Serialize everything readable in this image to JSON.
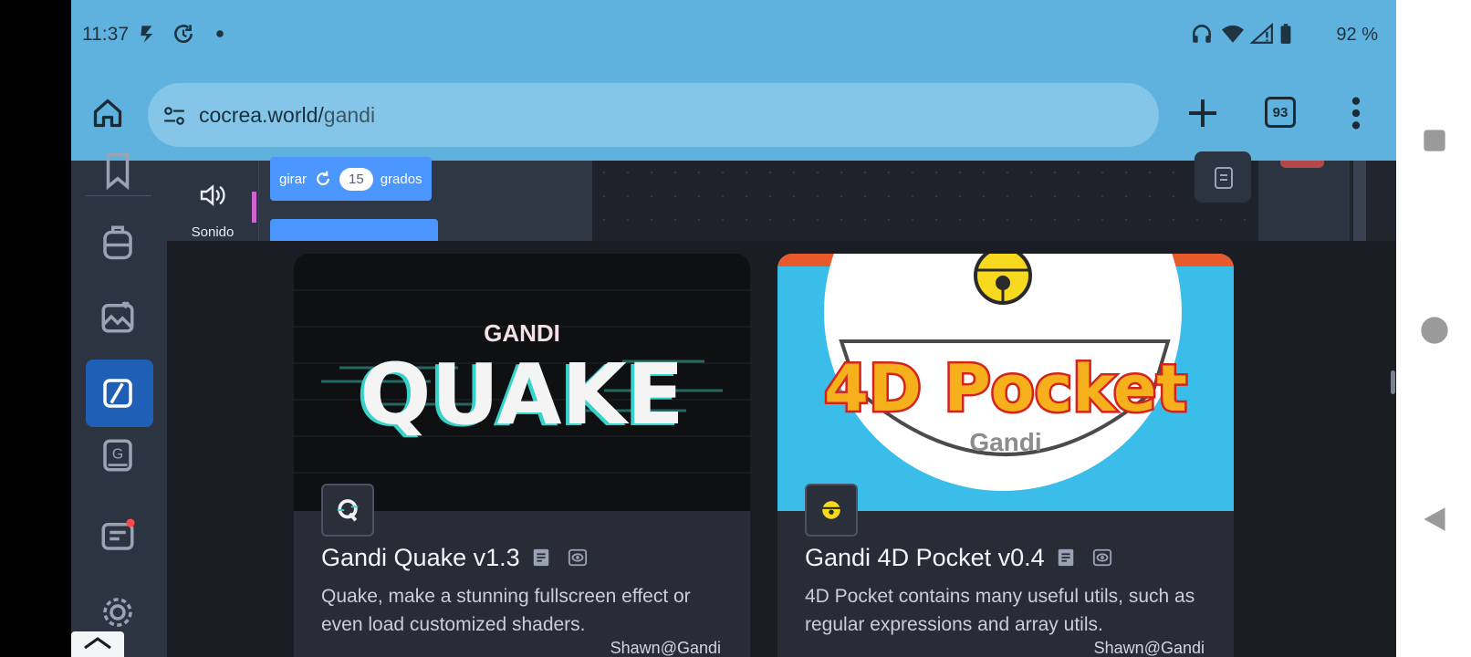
{
  "status_bar": {
    "time": "11:37",
    "battery_text": "92 %",
    "icons": [
      "app-notification-icon",
      "sync-icon",
      "dot-icon",
      "headphones-icon",
      "wifi-icon",
      "signal-icon",
      "battery-icon"
    ]
  },
  "browser": {
    "url_domain": "cocrea.world/",
    "url_path": "gandi",
    "tab_count": "93"
  },
  "workspace": {
    "category_label": "Sonido",
    "block": {
      "verb": "girar",
      "value": "15",
      "unit": "grados"
    }
  },
  "cards": [
    {
      "title": "Gandi Quake v1.3",
      "description": "Quake, make a stunning fullscreen effect or even load customized shaders.",
      "author": "Shawn@Gandi",
      "banner_small": "GANDI",
      "banner_big": "QUAKE",
      "banner_color": "#0f1012"
    },
    {
      "title": "Gandi 4D Pocket v0.4",
      "description": "4D Pocket contains many useful utils, such as regular expressions and array utils.",
      "author": "Shawn@Gandi",
      "banner_big": "4D Pocket",
      "banner_small": "Gandi",
      "banner_color": "#3bbde9"
    }
  ],
  "colors": {
    "browser_bar": "#60b2de",
    "url_box": "#85c6e8",
    "nav_active": "#1f5fb5",
    "block_blue": "#4c97ff",
    "card_bg": "#282c37"
  }
}
